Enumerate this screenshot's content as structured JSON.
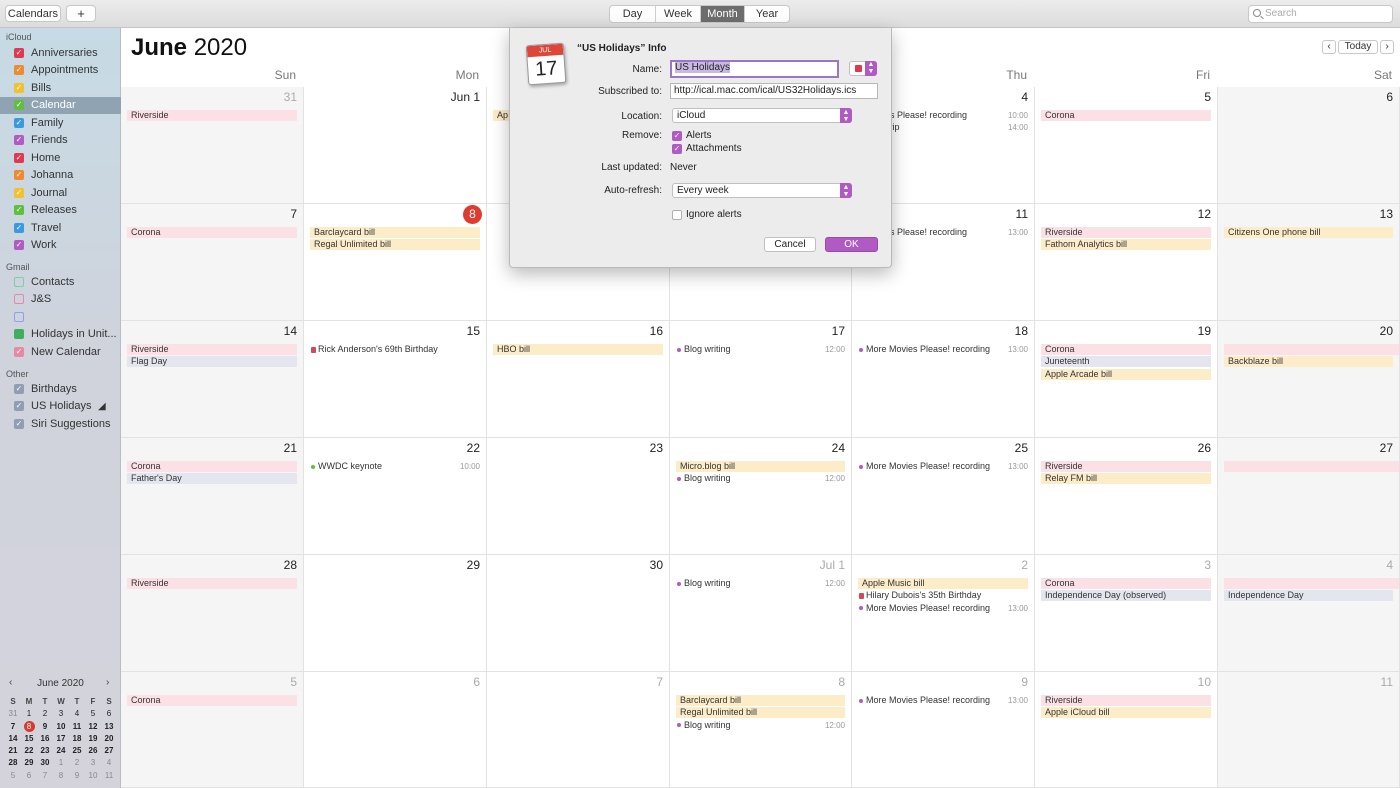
{
  "toolbar": {
    "calendars_label": "Calendars",
    "add_label": "+",
    "views": [
      "Day",
      "Week",
      "Month",
      "Year"
    ],
    "active_view": "Month",
    "search_placeholder": "Search"
  },
  "sidebar": {
    "icloud_header": "iCloud",
    "icloud": [
      {
        "name": "Anniversaries",
        "color": "#e0384f",
        "checked": true
      },
      {
        "name": "Appointments",
        "color": "#f08a30",
        "checked": true
      },
      {
        "name": "Bills",
        "color": "#f2c12e",
        "checked": true
      },
      {
        "name": "Calendar",
        "color": "#5fbf3f",
        "checked": true,
        "selected": true
      },
      {
        "name": "Family",
        "color": "#3a9ae0",
        "checked": true
      },
      {
        "name": "Friends",
        "color": "#b05bc4",
        "checked": true
      },
      {
        "name": "Home",
        "color": "#e0384f",
        "checked": true
      },
      {
        "name": "Johanna",
        "color": "#f08a30",
        "checked": true
      },
      {
        "name": "Journal",
        "color": "#f2c12e",
        "checked": true
      },
      {
        "name": "Releases",
        "color": "#5fbf3f",
        "checked": true
      },
      {
        "name": "Travel",
        "color": "#3a9ae0",
        "checked": true
      },
      {
        "name": "Work",
        "color": "#b05bc4",
        "checked": true
      }
    ],
    "gmail_header": "Gmail",
    "gmail": [
      {
        "name": "Contacts",
        "color": "#7ccfa0",
        "checked": false
      },
      {
        "name": "J&S",
        "color": "#e889a4",
        "checked": false
      },
      {
        "name": "",
        "color": "#8f9ff0",
        "checked": false
      },
      {
        "name": "Holidays in Unit...",
        "color": "#3fae5f",
        "checked": false,
        "filled": true
      },
      {
        "name": "New Calendar",
        "color": "#e889a4",
        "checked": true
      }
    ],
    "other_header": "Other",
    "other": [
      {
        "name": "Birthdays",
        "color": "#8f9eb3",
        "checked": true
      },
      {
        "name": "US Holidays",
        "color": "#8f9eb3",
        "checked": true,
        "feed": true
      },
      {
        "name": "Siri Suggestions",
        "color": "#8f9eb3",
        "checked": true
      }
    ],
    "feed_icon": "broadcast-icon"
  },
  "mini_calendar": {
    "title": "June 2020",
    "prev": "‹",
    "next": "›",
    "weekdays": [
      "S",
      "M",
      "T",
      "W",
      "T",
      "F",
      "S"
    ],
    "weeks": [
      [
        "31",
        "1",
        "2",
        "3",
        "4",
        "5",
        "6"
      ],
      [
        "7",
        "8",
        "9",
        "10",
        "11",
        "12",
        "13"
      ],
      [
        "14",
        "15",
        "16",
        "17",
        "18",
        "19",
        "20"
      ],
      [
        "21",
        "22",
        "23",
        "24",
        "25",
        "26",
        "27"
      ],
      [
        "28",
        "29",
        "30",
        "1",
        "2",
        "3",
        "4"
      ],
      [
        "5",
        "6",
        "7",
        "8",
        "9",
        "10",
        "11"
      ]
    ],
    "today": "8"
  },
  "main": {
    "month": "June",
    "year": "2020",
    "today_label": "Today",
    "prev": "‹",
    "next": "›",
    "weekdays": [
      "Sun",
      "Mon",
      "Tue",
      "Wed",
      "Thu",
      "Fri",
      "Sat"
    ]
  },
  "weeks": [
    [
      {
        "d": "31",
        "dim": true,
        "ev": [
          {
            "t": "Riverside",
            "s": "pink"
          }
        ]
      },
      {
        "d": "Jun 1",
        "ev": []
      },
      {
        "d": "",
        "ev": [
          {
            "t": "Ap",
            "s": "yellow"
          }
        ]
      },
      {
        "d": "",
        "ev": []
      },
      {
        "d": "4",
        "ev": [
          {
            "t": "Movies Please! recording",
            "s": "plain",
            "time": "10:00"
          },
          {
            "t": "Club trip",
            "s": "plain",
            "time": "14:00"
          }
        ]
      },
      {
        "d": "5",
        "ev": [
          {
            "t": "Corona",
            "s": "pink"
          }
        ]
      },
      {
        "d": "6",
        "ev": []
      }
    ],
    [
      {
        "d": "7",
        "ev": [
          {
            "t": "Corona",
            "s": "pink"
          }
        ]
      },
      {
        "d": "8",
        "today": true,
        "ev": [
          {
            "t": "Barclaycard bill",
            "s": "yellow"
          },
          {
            "t": "Regal Unlimited bill",
            "s": "yellow"
          }
        ]
      },
      {
        "d": "",
        "ev": []
      },
      {
        "d": "",
        "ev": []
      },
      {
        "d": "11",
        "ev": [
          {
            "t": "Movies Please! recording",
            "s": "plain",
            "time": "13:00"
          }
        ]
      },
      {
        "d": "12",
        "ev": [
          {
            "t": "Riverside",
            "s": "pink"
          },
          {
            "t": "Fathom Analytics bill",
            "s": "yellow"
          }
        ]
      },
      {
        "d": "13",
        "ev": [
          {
            "t": "Citizens One phone bill",
            "s": "yellow"
          }
        ]
      }
    ],
    [
      {
        "d": "14",
        "ev": [
          {
            "t": "Riverside",
            "s": "pink"
          },
          {
            "t": "Flag Day",
            "s": "blue"
          }
        ]
      },
      {
        "d": "15",
        "ev": [
          {
            "t": "Rick Anderson's 69th Birthday",
            "s": "gift"
          }
        ]
      },
      {
        "d": "16",
        "ev": [
          {
            "t": "HBO bill",
            "s": "yellow"
          }
        ]
      },
      {
        "d": "17",
        "ev": [
          {
            "t": "Blog writing",
            "s": "dot",
            "time": "12:00"
          }
        ]
      },
      {
        "d": "18",
        "ev": [
          {
            "t": "More Movies Please! recording",
            "s": "dot",
            "time": "13:00"
          }
        ]
      },
      {
        "d": "19",
        "ev": [
          {
            "t": "Corona",
            "s": "pink"
          },
          {
            "t": "Juneteenth",
            "s": "blue"
          },
          {
            "t": "Apple Arcade bill",
            "s": "yellow"
          }
        ]
      },
      {
        "d": "20",
        "ev": [
          {
            "t": "",
            "s": "pink"
          },
          {
            "t": "Backblaze bill",
            "s": "yellow"
          }
        ]
      }
    ],
    [
      {
        "d": "21",
        "ev": [
          {
            "t": "Corona",
            "s": "pink"
          },
          {
            "t": "Father's Day",
            "s": "blue"
          }
        ]
      },
      {
        "d": "22",
        "ev": [
          {
            "t": "WWDC keynote",
            "s": "dot",
            "dc": "#5fbf3f",
            "time": "10:00"
          }
        ]
      },
      {
        "d": "23",
        "ev": []
      },
      {
        "d": "24",
        "ev": [
          {
            "t": "Micro.blog bill",
            "s": "yellow"
          },
          {
            "t": "Blog writing",
            "s": "dot",
            "time": "12:00"
          }
        ]
      },
      {
        "d": "25",
        "ev": [
          {
            "t": "More Movies Please! recording",
            "s": "dot",
            "time": "13:00"
          }
        ]
      },
      {
        "d": "26",
        "ev": [
          {
            "t": "Riverside",
            "s": "pink"
          },
          {
            "t": "Relay FM bill",
            "s": "yellow"
          }
        ]
      },
      {
        "d": "27",
        "ev": [
          {
            "t": "",
            "s": "pink"
          }
        ]
      }
    ],
    [
      {
        "d": "28",
        "ev": [
          {
            "t": "Riverside",
            "s": "pink"
          }
        ]
      },
      {
        "d": "29",
        "ev": []
      },
      {
        "d": "30",
        "ev": []
      },
      {
        "d": "Jul 1",
        "dim": true,
        "ev": [
          {
            "t": "Blog writing",
            "s": "dot",
            "time": "12:00"
          }
        ]
      },
      {
        "d": "2",
        "dim": true,
        "ev": [
          {
            "t": "Apple Music bill",
            "s": "yellow"
          },
          {
            "t": "Hilary Dubois's 35th Birthday",
            "s": "gift"
          },
          {
            "t": "More Movies Please! recording",
            "s": "dot",
            "time": "13:00"
          }
        ]
      },
      {
        "d": "3",
        "dim": true,
        "ev": [
          {
            "t": "Corona",
            "s": "pink"
          },
          {
            "t": "Independence Day (observed)",
            "s": "blue"
          }
        ]
      },
      {
        "d": "4",
        "dim": true,
        "ev": [
          {
            "t": "",
            "s": "pink"
          },
          {
            "t": "Independence Day",
            "s": "blue"
          }
        ]
      }
    ],
    [
      {
        "d": "5",
        "dim": true,
        "ev": [
          {
            "t": "Corona",
            "s": "pink"
          }
        ]
      },
      {
        "d": "6",
        "dim": true,
        "ev": []
      },
      {
        "d": "7",
        "dim": true,
        "ev": []
      },
      {
        "d": "8",
        "dim": true,
        "ev": [
          {
            "t": "Barclaycard bill",
            "s": "yellow"
          },
          {
            "t": "Regal Unlimited bill",
            "s": "yellow"
          },
          {
            "t": "Blog writing",
            "s": "dot",
            "time": "12:00"
          }
        ]
      },
      {
        "d": "9",
        "dim": true,
        "ev": [
          {
            "t": "More Movies Please! recording",
            "s": "dot",
            "time": "13:00"
          }
        ]
      },
      {
        "d": "10",
        "dim": true,
        "ev": [
          {
            "t": "Riverside",
            "s": "pink"
          },
          {
            "t": "Apple iCloud bill",
            "s": "yellow"
          }
        ]
      },
      {
        "d": "11",
        "dim": true,
        "ev": []
      }
    ]
  ],
  "dialog": {
    "title": "“US Holidays” Info",
    "icon_month": "JUL",
    "icon_day": "17",
    "name_label": "Name:",
    "name_value": "US Holidays",
    "subscribed_label": "Subscribed to:",
    "subscribed_value": "http://ical.mac.com/ical/US32Holidays.ics",
    "location_label": "Location:",
    "location_value": "iCloud",
    "remove_label": "Remove:",
    "alerts_label": "Alerts",
    "attachments_label": "Attachments",
    "last_updated_label": "Last updated:",
    "last_updated_value": "Never",
    "auto_refresh_label": "Auto-refresh:",
    "auto_refresh_value": "Every week",
    "ignore_alerts_label": "Ignore alerts",
    "cancel_label": "Cancel",
    "ok_label": "OK",
    "accent": "#b05bc4"
  }
}
